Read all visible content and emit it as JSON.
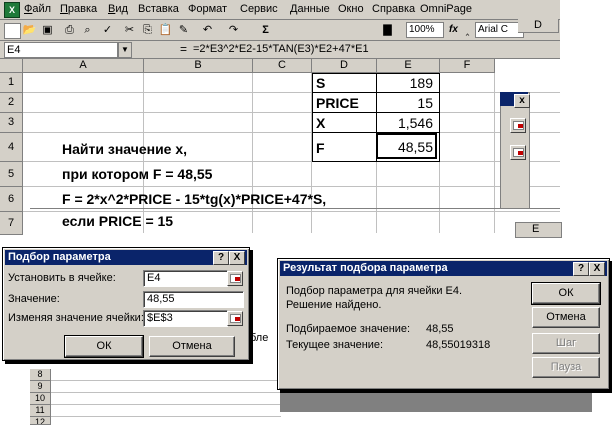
{
  "app": {
    "icon": "excel-icon"
  },
  "menu": {
    "items": [
      {
        "key": "Ф",
        "rest": "айл"
      },
      {
        "key": "П",
        "rest": "равка"
      },
      {
        "key": "В",
        "rest": "ид"
      },
      {
        "key": "",
        "rest": "Вставка"
      },
      {
        "key": "",
        "rest": "Формат"
      },
      {
        "key": "",
        "rest": "Сервис"
      },
      {
        "key": "",
        "rest": "Данные"
      },
      {
        "key": "",
        "rest": "Окно"
      },
      {
        "key": "",
        "rest": "Справка"
      },
      {
        "key": "",
        "rest": "OmniPage"
      }
    ]
  },
  "toolbar": {
    "zoom": "100%",
    "font": "Arial C",
    "sigma": "Σ",
    "fx": "fx"
  },
  "formula_bar": {
    "name_box": "E4",
    "eq": "=",
    "formula": "=2*E3^2*E2-15*TAN(E3)*E2+47*E1"
  },
  "grid": {
    "columns": [
      "A",
      "B",
      "C",
      "D",
      "E",
      "F"
    ],
    "extra_column": "D",
    "rows": [
      "1",
      "2",
      "3",
      "4",
      "5",
      "6",
      "7"
    ],
    "lower_rows": [
      "8",
      "9",
      "10",
      "11",
      "12"
    ],
    "lower_col_e": "E"
  },
  "table": {
    "labels": [
      "S",
      "PRICE",
      "X",
      "F"
    ],
    "values": [
      "189",
      "15",
      "1,546",
      "48,55"
    ]
  },
  "sheet_text": {
    "line1": "Найти значение х,",
    "line2": "при котором F = 48,55",
    "line3": "F = 2*x^2*PRICE - 15*tg(x)*PRICE+47*S,",
    "line4": "если  PRICE = 15"
  },
  "goal_seek": {
    "title": "Подбор параметра",
    "help": "?",
    "close": "X",
    "set_cell_label": "Установить в ячейке:",
    "set_cell_value": "E4",
    "to_value_label": "Значение:",
    "to_value_value": "48,55",
    "changing_label": "Изменяя значение ячейки:",
    "changing_value": "$E$3",
    "ok": "ОК",
    "cancel": "Отмена"
  },
  "goal_seek_result": {
    "title": "Результат подбора параметра",
    "help": "?",
    "close": "X",
    "line1": "Подбор параметра для ячейки E4.",
    "line2": "Решение найдено.",
    "target_label": "Подбираемое значение:",
    "target_value": "48,55",
    "current_label": "Текущее значение:",
    "current_value": "48,55019318",
    "ok": "ОК",
    "cancel": "Отмена",
    "step": "Шаг",
    "pause": "Пауза"
  },
  "fragments": {
    "bleed_text": "бле"
  }
}
